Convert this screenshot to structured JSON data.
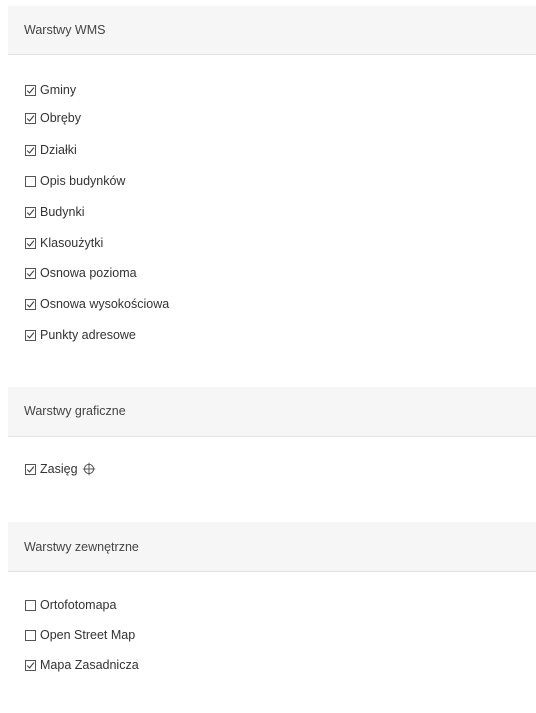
{
  "sections": [
    {
      "title": "Warstwy WMS",
      "items": [
        {
          "label": "Gminy",
          "checked": true
        },
        {
          "label": "Obręby",
          "checked": true
        },
        {
          "label": "Działki",
          "checked": true
        },
        {
          "label": "Opis budynków",
          "checked": false
        },
        {
          "label": "Budynki",
          "checked": true
        },
        {
          "label": "Klasoużytki",
          "checked": true
        },
        {
          "label": "Osnowa pozioma",
          "checked": true
        },
        {
          "label": "Osnowa wysokościowa",
          "checked": true
        },
        {
          "label": "Punkty adresowe",
          "checked": true
        }
      ]
    },
    {
      "title": "Warstwy graficzne",
      "items": [
        {
          "label": "Zasięg",
          "checked": true,
          "icon": "crosshair-icon"
        }
      ]
    },
    {
      "title": "Warstwy zewnętrzne",
      "items": [
        {
          "label": "Ortofotomapa",
          "checked": false
        },
        {
          "label": "Open Street Map",
          "checked": false
        },
        {
          "label": "Mapa Zasadnicza",
          "checked": true
        }
      ]
    }
  ],
  "colors": {
    "header_background": "#f6f6f6",
    "divider": "#e2e2e2",
    "text": "#333333"
  }
}
